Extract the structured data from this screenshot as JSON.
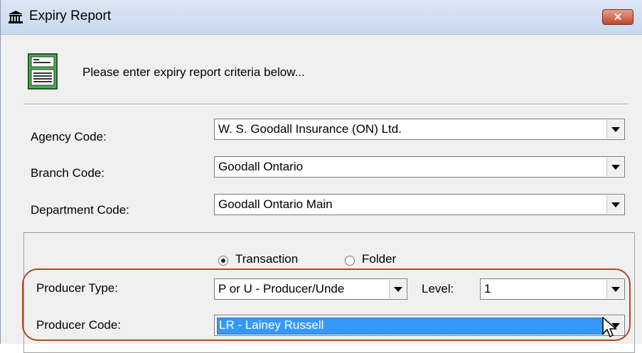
{
  "window": {
    "title": "Expiry Report",
    "close_label": "✕"
  },
  "instructions": "Please enter expiry report criteria below...",
  "fields": {
    "agency": {
      "label": "Agency Code:",
      "value": "W. S. Goodall Insurance (ON) Ltd."
    },
    "branch": {
      "label": "Branch Code:",
      "value": "Goodall Ontario"
    },
    "department": {
      "label": "Department Code:",
      "value": "Goodall Ontario Main"
    }
  },
  "mode": {
    "options": [
      "Transaction",
      "Folder"
    ],
    "selected": "Transaction"
  },
  "producer": {
    "type_label": "Producer Type:",
    "type_value": "P or U - Producer/Unde",
    "level_label": "Level:",
    "level_value": "1",
    "code_label": "Producer Code:",
    "code_value": "LR - Lainey Russell"
  },
  "colors": {
    "highlight_ring": "#b04a21",
    "selection": "#3399ff"
  },
  "icons": {
    "app": "bank-building-icon",
    "document": "report-document-icon"
  }
}
